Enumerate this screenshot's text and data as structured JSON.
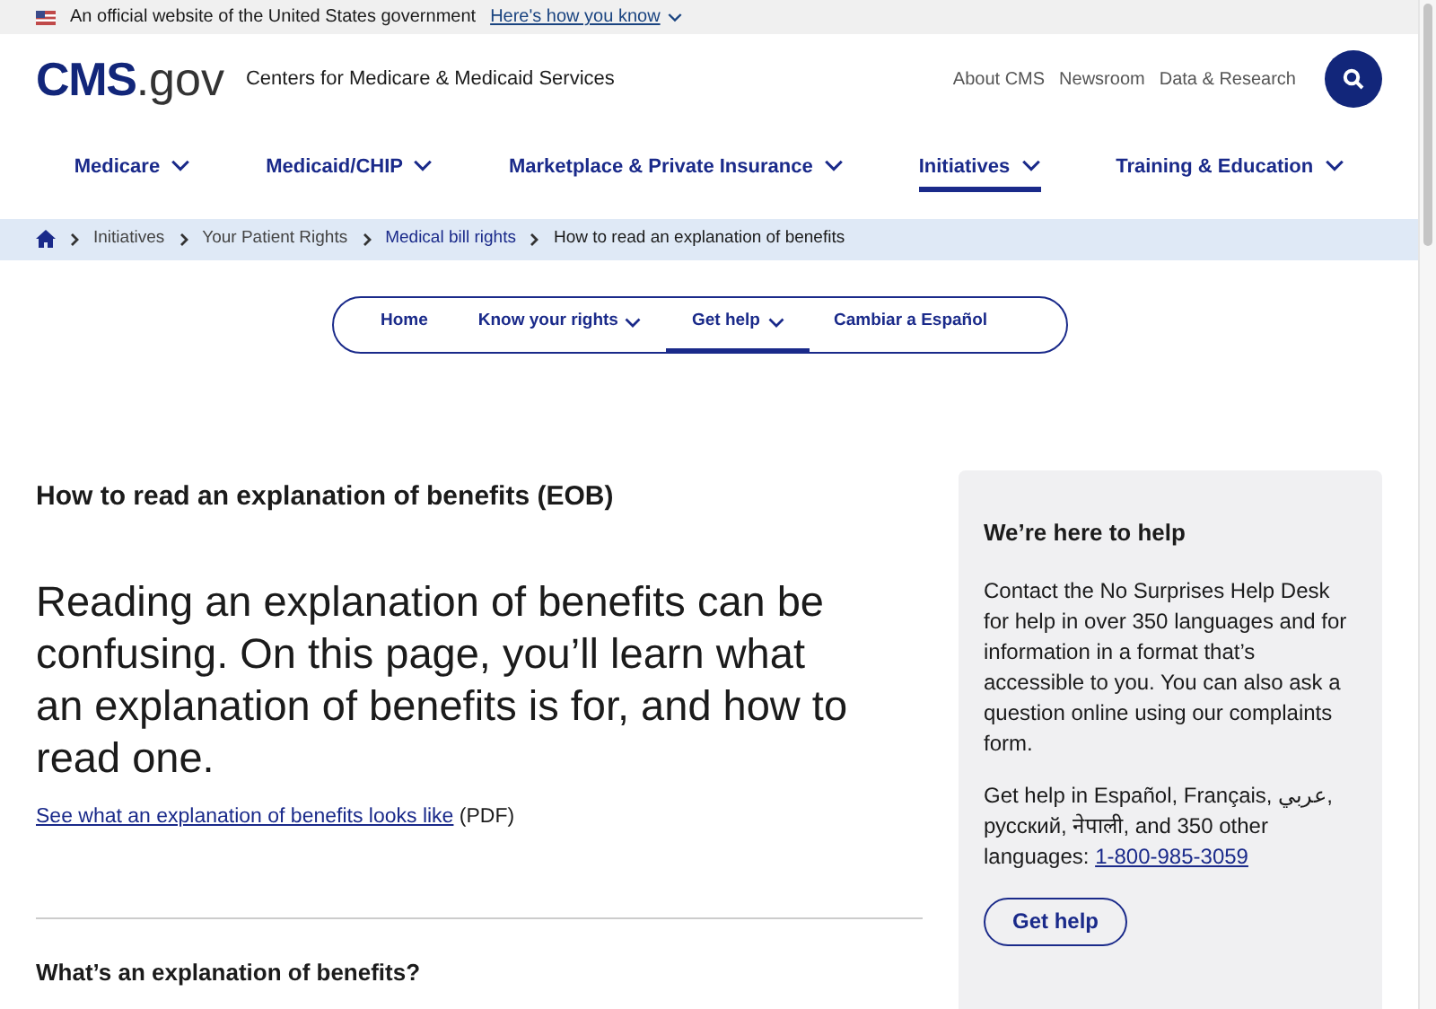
{
  "gov_banner": {
    "text": "An official website of the United States government",
    "link": "Here's how you know"
  },
  "header": {
    "logo_main": "CMS",
    "logo_suffix": ".gov",
    "agency": "Centers for Medicare & Medicaid Services",
    "utility_links": [
      "About CMS",
      "Newsroom",
      "Data & Research"
    ]
  },
  "main_nav": [
    {
      "label": "Medicare",
      "has_menu": true,
      "selected": false
    },
    {
      "label": "Medicaid/CHIP",
      "has_menu": true,
      "selected": false
    },
    {
      "label": "Marketplace & Private Insurance",
      "has_menu": true,
      "selected": false
    },
    {
      "label": "Initiatives",
      "has_menu": true,
      "selected": true
    },
    {
      "label": "Training & Education",
      "has_menu": true,
      "selected": false
    }
  ],
  "breadcrumb": [
    {
      "label": "Initiatives",
      "kind": "plain"
    },
    {
      "label": "Your Patient Rights",
      "kind": "plain"
    },
    {
      "label": "Medical bill rights",
      "kind": "link"
    },
    {
      "label": "How to read an explanation of benefits",
      "kind": "current"
    }
  ],
  "sub_nav": [
    {
      "label": "Home",
      "has_menu": false,
      "selected": false
    },
    {
      "label": "Know your rights",
      "has_menu": true,
      "selected": false
    },
    {
      "label": "Get help",
      "has_menu": true,
      "selected": true
    },
    {
      "label": "Cambiar a Español",
      "has_menu": false,
      "selected": false
    }
  ],
  "article": {
    "title": "How to read an explanation of benefits (EOB)",
    "lead": "Reading an explanation of benefits can be confusing. On this page, you’ll learn what an explanation of benefits is for, and how to read one.",
    "link": "See what an explanation of benefits looks like",
    "link_suffix": "(PDF)",
    "section_heading": "What’s an explanation of benefits?"
  },
  "help_card": {
    "title": "We’re here to help",
    "paragraph": "Contact the No Surprises Help Desk for help in over 350 languages and for information in a format that’s accessible to you. You can also ask a question online using our complaints form.",
    "languages_text": "Get help in Español, Français, عربي, русский, नेपाली, and 350 other languages:",
    "phone": "1-800-985-3059",
    "button": "Get help"
  }
}
